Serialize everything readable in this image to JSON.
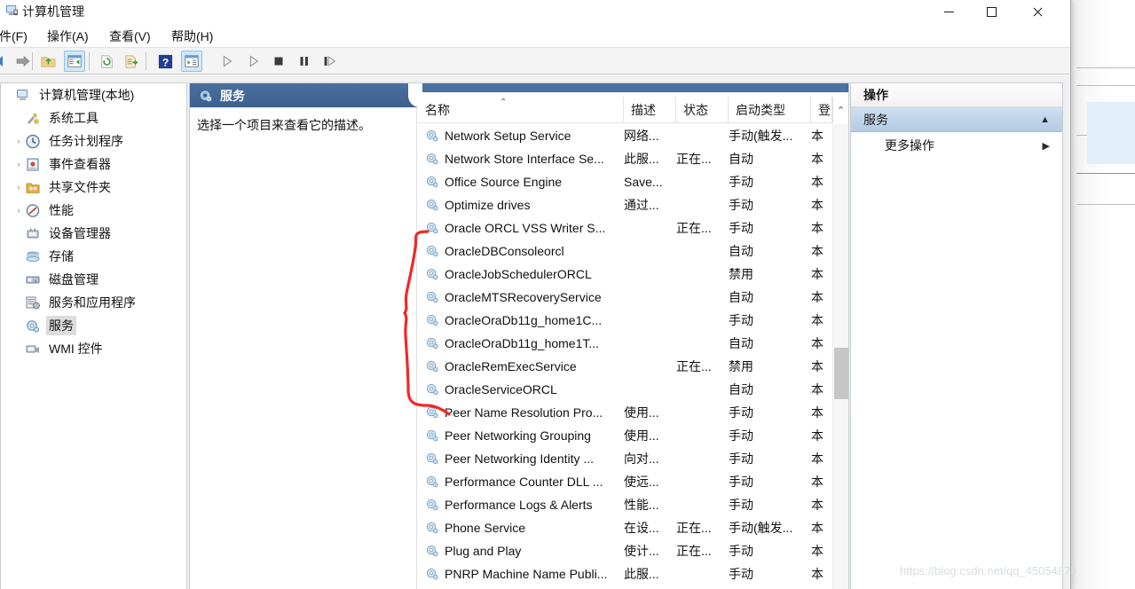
{
  "window": {
    "title": "计算机管理",
    "icon": "computer-management-icon",
    "controls": {
      "minimize": "—",
      "maximize": "☐",
      "close": "✕"
    }
  },
  "menu": {
    "items": [
      {
        "label": "件(F)",
        "name": "file"
      },
      {
        "label": "操作(A)",
        "name": "action"
      },
      {
        "label": "查看(V)",
        "name": "view"
      },
      {
        "label": "帮助(H)",
        "name": "help"
      }
    ]
  },
  "toolbar": {
    "buttons": [
      {
        "name": "back-icon",
        "selected": false
      },
      {
        "name": "forward-icon",
        "selected": false
      },
      {
        "name": "up-folder-icon",
        "selected": false
      },
      {
        "name": "show-hide-tree-icon",
        "selected": true
      },
      {
        "name": "refresh-icon",
        "selected": false
      },
      {
        "name": "export-list-icon",
        "selected": false
      },
      {
        "name": "help-icon",
        "selected": false
      },
      {
        "name": "properties-icon",
        "selected": true
      },
      {
        "name": "start-service-icon",
        "selected": false
      },
      {
        "name": "start-all-icon",
        "selected": false
      },
      {
        "name": "stop-service-icon",
        "selected": false
      },
      {
        "name": "pause-service-icon",
        "selected": false
      },
      {
        "name": "restart-service-icon",
        "selected": false
      }
    ]
  },
  "tree": {
    "nodes": [
      {
        "label": "计算机管理(本地)",
        "indent": 0,
        "twisty": "",
        "icon": "computer-icon",
        "selected": false
      },
      {
        "label": "系统工具",
        "indent": 1,
        "twisty": "",
        "icon": "system-tools-icon",
        "selected": false
      },
      {
        "label": "任务计划程序",
        "indent": 2,
        "twisty": "›",
        "icon": "task-scheduler-icon",
        "selected": false
      },
      {
        "label": "事件查看器",
        "indent": 2,
        "twisty": "›",
        "icon": "event-viewer-icon",
        "selected": false
      },
      {
        "label": "共享文件夹",
        "indent": 2,
        "twisty": "›",
        "icon": "shared-folders-icon",
        "selected": false
      },
      {
        "label": "性能",
        "indent": 2,
        "twisty": "›",
        "icon": "performance-icon",
        "selected": false
      },
      {
        "label": "设备管理器",
        "indent": 2,
        "twisty": "",
        "icon": "device-manager-icon",
        "selected": false
      },
      {
        "label": "存储",
        "indent": 1,
        "twisty": "",
        "icon": "storage-icon",
        "selected": false
      },
      {
        "label": "磁盘管理",
        "indent": 2,
        "twisty": "",
        "icon": "disk-management-icon",
        "selected": false
      },
      {
        "label": "服务和应用程序",
        "indent": 1,
        "twisty": "",
        "icon": "services-apps-icon",
        "selected": false
      },
      {
        "label": "服务",
        "indent": 2,
        "twisty": "",
        "icon": "services-icon",
        "selected": true
      },
      {
        "label": "WMI 控件",
        "indent": 2,
        "twisty": "",
        "icon": "wmi-control-icon",
        "selected": false
      }
    ]
  },
  "center": {
    "header_title": "服务",
    "header_icon": "services-icon",
    "detail_text": "选择一个项目来查看它的描述。"
  },
  "list": {
    "columns": [
      {
        "label": "名称",
        "name": "name",
        "sorted": true
      },
      {
        "label": "描述",
        "name": "description",
        "sorted": false
      },
      {
        "label": "状态",
        "name": "status",
        "sorted": false
      },
      {
        "label": "启动类型",
        "name": "startup",
        "sorted": false
      },
      {
        "label": "登",
        "name": "logon-as",
        "sorted": false
      }
    ],
    "sort_indicator": "⌃",
    "scroll_cap_indicator": "⌃",
    "rows": [
      {
        "name": "Network Setup Service",
        "description": "网络...",
        "status": "",
        "startup": "手动(触发...",
        "logon": "本"
      },
      {
        "name": "Network Store Interface Se...",
        "description": "此服...",
        "status": "正在...",
        "startup": "自动",
        "logon": "本"
      },
      {
        "name": "Office  Source Engine",
        "description": "Save...",
        "status": "",
        "startup": "手动",
        "logon": "本"
      },
      {
        "name": "Optimize drives",
        "description": "通过...",
        "status": "",
        "startup": "手动",
        "logon": "本"
      },
      {
        "name": "Oracle ORCL VSS Writer S...",
        "description": "",
        "status": "正在...",
        "startup": "手动",
        "logon": "本"
      },
      {
        "name": "OracleDBConsoleorcl",
        "description": "",
        "status": "",
        "startup": "自动",
        "logon": "本"
      },
      {
        "name": "OracleJobSchedulerORCL",
        "description": "",
        "status": "",
        "startup": "禁用",
        "logon": "本"
      },
      {
        "name": "OracleMTSRecoveryService",
        "description": "",
        "status": "",
        "startup": "自动",
        "logon": "本"
      },
      {
        "name": "OracleOraDb11g_home1C...",
        "description": "",
        "status": "",
        "startup": "手动",
        "logon": "本"
      },
      {
        "name": "OracleOraDb11g_home1T...",
        "description": "",
        "status": "",
        "startup": "自动",
        "logon": "本"
      },
      {
        "name": "OracleRemExecService",
        "description": "",
        "status": "正在...",
        "startup": "禁用",
        "logon": "本"
      },
      {
        "name": "OracleServiceORCL",
        "description": "",
        "status": "",
        "startup": "自动",
        "logon": "本"
      },
      {
        "name": "Peer Name Resolution Pro...",
        "description": "使用...",
        "status": "",
        "startup": "手动",
        "logon": "本"
      },
      {
        "name": "Peer Networking Grouping",
        "description": "使用...",
        "status": "",
        "startup": "手动",
        "logon": "本"
      },
      {
        "name": "Peer Networking Identity ...",
        "description": "向对...",
        "status": "",
        "startup": "手动",
        "logon": "本"
      },
      {
        "name": "Performance Counter DLL ...",
        "description": "使远...",
        "status": "",
        "startup": "手动",
        "logon": "本"
      },
      {
        "name": "Performance Logs & Alerts",
        "description": "性能...",
        "status": "",
        "startup": "手动",
        "logon": "本"
      },
      {
        "name": "Phone Service",
        "description": "在设...",
        "status": "正在...",
        "startup": "手动(触发...",
        "logon": "本"
      },
      {
        "name": "Plug and Play",
        "description": "使计...",
        "status": "正在...",
        "startup": "手动",
        "logon": "本"
      },
      {
        "name": "PNRP Machine Name Publi...",
        "description": "此服...",
        "status": "",
        "startup": "手动",
        "logon": "本"
      }
    ]
  },
  "actions": {
    "title": "操作",
    "group_label": "服务",
    "group_caret": "▲",
    "items": [
      {
        "label": "更多操作",
        "submenu_arrow": "▶",
        "name": "more-actions"
      }
    ]
  },
  "annotation": {
    "type": "red-brace",
    "color": "#ef2929"
  },
  "watermark": {
    "text": "https://blog.csdn.net/qq_45054878"
  }
}
